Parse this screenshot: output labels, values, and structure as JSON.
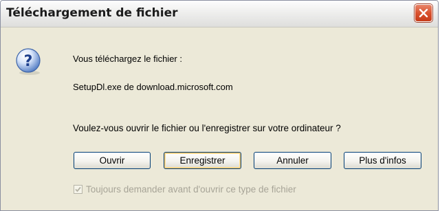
{
  "window": {
    "title": "Téléchargement de fichier"
  },
  "dialog": {
    "line1": "Vous téléchargez le fichier :",
    "line2": "SetupDl.exe de download.microsoft.com",
    "question": "Voulez-vous ouvrir le fichier ou l'enregistrer sur votre ordinateur ?",
    "icon": "question-icon"
  },
  "buttons": {
    "open": "Ouvrir",
    "save": "Enregistrer",
    "cancel": "Annuler",
    "info": "Plus d'infos"
  },
  "checkbox": {
    "label": "Toujours demander avant d'ouvrir ce type de fichier",
    "checked": true,
    "disabled": true
  },
  "colors": {
    "title_text": "#1b1b1b",
    "dialog_bg": "#ece9d8",
    "close_button": "#d9522f",
    "button_border": "#003c74",
    "disabled_text": "#a7a497"
  }
}
